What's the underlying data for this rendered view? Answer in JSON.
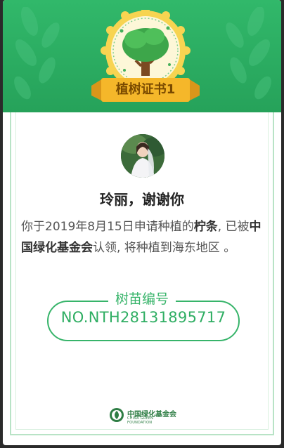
{
  "certificate": {
    "badge_title": "植树证书",
    "badge_number": "1",
    "name_line": "玲丽，谢谢你",
    "message_part1": "你于2019年8月15日申请种植的",
    "species": "柠条",
    "message_part2": ", 已被",
    "organization": "中国绿化基金会",
    "message_part3": "认领, 将种植到海东地区 。",
    "seedling_code_label": "树苗编号",
    "seedling_code": "NO.NTH28131895717"
  },
  "footer": {
    "logo_cn": "中国绿化基金会",
    "logo_en": "CHINA GREEN FOUNDATION"
  },
  "colors": {
    "header_green": "#2aa85e",
    "accent_green": "#37b46a",
    "badge_gold": "#f2c53d",
    "ribbon_gold": "#f5b72a"
  }
}
